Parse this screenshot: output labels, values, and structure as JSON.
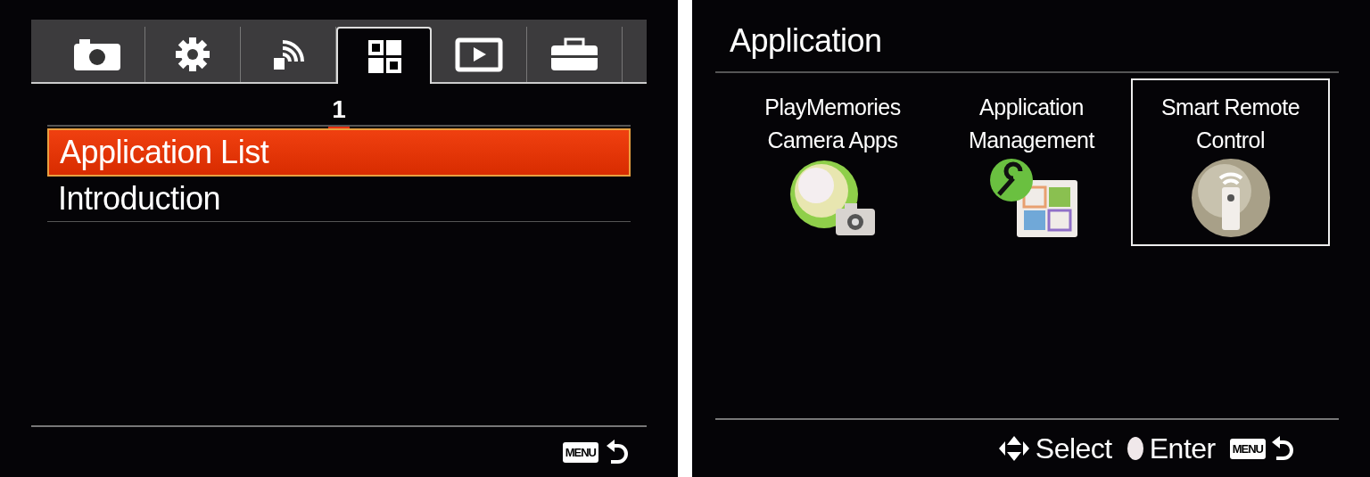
{
  "menu_screen": {
    "tabs": [
      {
        "selected": false
      },
      {
        "selected": false
      },
      {
        "selected": false
      },
      {
        "selected": true
      },
      {
        "selected": false
      },
      {
        "selected": false
      }
    ],
    "page": "1",
    "items": [
      {
        "label": "Application List",
        "selected": true
      },
      {
        "label": "Introduction",
        "selected": false
      }
    ],
    "menu_key": "MENU"
  },
  "application_screen": {
    "title": "Application",
    "apps": [
      {
        "label": "PlayMemories\nCamera Apps",
        "selected": false
      },
      {
        "label": "Application\nManagement",
        "selected": false
      },
      {
        "label": "Smart Remote\nControl",
        "selected": true
      }
    ],
    "hints": [
      {
        "kind": "select",
        "label": "Select"
      },
      {
        "kind": "enter",
        "label": "Enter"
      }
    ],
    "menu_key": "MENU"
  }
}
